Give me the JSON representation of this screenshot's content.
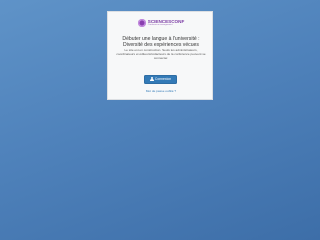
{
  "logo": {
    "main": "SCIENCESCONF",
    "sub": "Conference management"
  },
  "page": {
    "title": "Débuter une langue à l'université : Diversité des expériences vécues",
    "description": "Le site est en construction. Seuls les administrateurs, coordinateurs et éditeurs/rédacteurs de la conférence peuvent se connecter."
  },
  "auth": {
    "login_label": "Connexion",
    "forgot_password": "Mot de passe oublié ?"
  },
  "colors": {
    "primary": "#337ab7",
    "background": "#4f82bb",
    "logo": "#8a3fb0"
  }
}
